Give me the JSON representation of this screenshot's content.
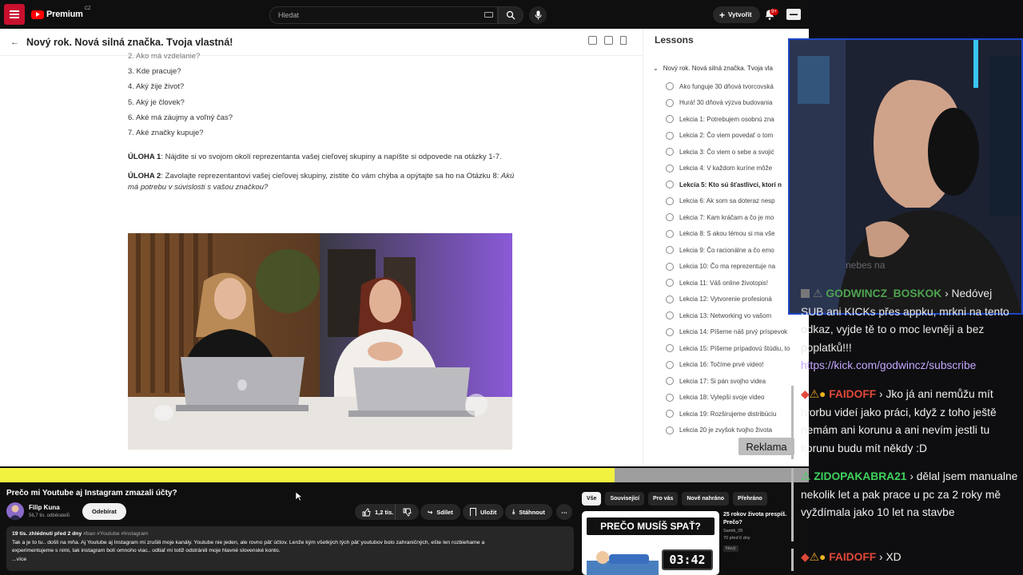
{
  "topbar": {
    "brand": "Premium",
    "country": "CZ",
    "search_placeholder": "Hledat",
    "create_label": "Vytvořit",
    "notifications_badge": "9+"
  },
  "course": {
    "title": "Nový rok. Nová silná značka. Tvoja vlastná!",
    "list_partial": "2. Ako má vzdelanie?",
    "list": [
      "3. Kde pracuje?",
      "4. Aký žije život?",
      "5. Aký je človek?",
      "6. Aké má záujmy a voľný čas?",
      "7. Aké značky kupuje?"
    ],
    "task1_label": "ÚLOHA 1",
    "task1_text": ": Nájdite si vo svojom okolí reprezentanta vašej cieľovej skupiny a napíšte si odpovede na otázky 1-7.",
    "task2_label": "ÚLOHA 2",
    "task2_text": ": Zavolajte reprezentantovi vašej cieľovej skupiny, zistite čo vám chýba a opýtajte sa ho na Otázku 8: ",
    "task2_question": "Akú má potrebu v súvislosti s vašou značkou?"
  },
  "lessons": {
    "title": "Lessons",
    "section": "Nový rok. Nová silná značka. Tvoja vla",
    "items": [
      "Ako funguje 30 dňová tvorcovská",
      "Hurá! 30 dňová výzva budovania",
      "Lekcia 1: Potrebujem osobnú zna",
      "Lekcia 2: Čo viem povedať o tom",
      "Lekcia 3: Čo viem o sebe a svojić",
      "Lekcia 4: V každom kuríne môže",
      "Lekcia 5: Kto sú šťastlivci, ktorí n",
      "Lekcia 6: Ak som sa doteraz nesp",
      "Lekcia 7: Kam kráčam a čo je mo",
      "Lekcia 8: S akou témou si ma vše",
      "Lekcia 9: Čo racionálne a čo emo",
      "Lekcia 10: Čo ma reprezentuje na",
      "Lekcia 11: Váš online životopis!",
      "Lekcia 12: Vytvorenie profesioná",
      "Lekcia 13: Networking vo vašom",
      "Lekcia 14: Píšeme náš prvý príspevok",
      "Lekcia 15: Píšeme prípadovú štúdiu, to",
      "Lekcia 16: Točíme prvé video!",
      "Lekcia 17: Si pán svojho videa",
      "Lekcia 18: Vylepši svoje video",
      "Lekcia 19: Rozširujeme distribúciu",
      "Lekcia 20 je zvyšok tvojho života"
    ],
    "active_index": 6
  },
  "ad_label": "Reklama",
  "progress": 0.76,
  "video": {
    "title": "Prečo mi Youtube aj Instagram zmazali účty?",
    "channel": "Filip Kuna",
    "subscribers": "56,7 tis. odběratelů",
    "subscribe_label": "Odebírat",
    "likes": "1,2 tis.",
    "share_label": "Sdílet",
    "save_label": "Uložit",
    "download_label": "Stáhnout",
    "desc_meta": "19 tis. zhlédnutí  před 2 dny ",
    "desc_tags": "#ban #Youtube #Instagram",
    "desc_line1": "Tak a je to tu.. došli na mňa. Aj Youtube aj Instagram mi zrušili moje kanály. Youtube nie jeden, ale rovno päť účtov. Lenže kým všetkých tých päť youtubov bolo zahraničných, ešte len rozbiehame a",
    "desc_line2": "experimentujeme s nimi, tak instagram bolí omnoho viac.. odtiaľ mi totiž odstránili moje hlavné slovenské konto.",
    "desc_more": "...více"
  },
  "chips": [
    "Vše",
    "Související",
    "Pro vás",
    "Nově nahráno",
    "Přehráno"
  ],
  "recommended": {
    "thumb_text": "PREČO MUSÍŠ SPAŤ?",
    "thumb_clock": "03:42",
    "title": "25 rokov života prespíš. Prečo?",
    "channel": "Samik_05",
    "stats": "70  před 6 dny",
    "badge": "Nový"
  },
  "chat": [
    {
      "user": "GODWINCZ_BOSKOK",
      "text": "› Nedóvej SUB ani KICKs přes appku, mrkni na tento odkaz, vyjde tě to o moc levněji a bez poplatků!!!",
      "url": "https://kick.com/godwincz/subscribe",
      "color": "#3fd25c"
    },
    {
      "user": "FAIDOFF",
      "text": "› Jko já ani nemůžu mít tvorbu videí jako práci, když z toho ještě nemám ani korunu a ani nevím jestli tu korunu budu mít někdy :D",
      "color": "#e0483a"
    },
    {
      "user": "ZIDOPAKABRA21",
      "text": "› dělal jsem manualne nekolik let a pak prace u pc za 2 roky mě vyždímala jako 10 let na stavbe",
      "color": "#3fd25c"
    },
    {
      "user": "FAIDOFF",
      "text": "› XD",
      "color": "#e0483a"
    }
  ],
  "cam_overlay_text": "nebes na"
}
